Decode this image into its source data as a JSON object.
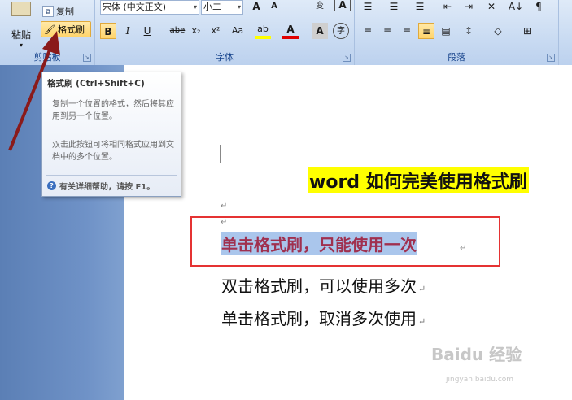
{
  "ribbon": {
    "clipboard": {
      "paste_label": "粘贴",
      "copy_label": "复制",
      "format_painter_label": "格式刷",
      "group_label": "剪贴板"
    },
    "font": {
      "font_name": "宋体 (中文正文)",
      "font_size": "小二",
      "bold": "B",
      "italic": "I",
      "underline": "U",
      "strike": "abe",
      "subscript": "x₂",
      "superscript": "x²",
      "change_case": "Aa",
      "group_label": "字体"
    },
    "paragraph": {
      "group_label": "段落"
    }
  },
  "tooltip": {
    "title": "格式刷 (Ctrl+Shift+C)",
    "desc1": "复制一个位置的格式，然后将其应用到另一个位置。",
    "desc2": "双击此按钮可将相同格式应用到文档中的多个位置。",
    "help": "有关详细帮助，请按 F1。"
  },
  "document": {
    "title": "word 如何完美使用格式刷",
    "para_mark": "↵",
    "line1": "单击格式刷，只能使用一次",
    "line2": "双击格式刷，可以使用多次",
    "line3": "单击格式刷，取消多次使用"
  },
  "watermark": {
    "brand": "Baidu 经验",
    "url": "jingyan.baidu.com"
  },
  "colors": {
    "highlight": "#ffff00",
    "selection": "#aac6ec",
    "red_box": "#e53333",
    "arrow": "#8a1a1a"
  }
}
